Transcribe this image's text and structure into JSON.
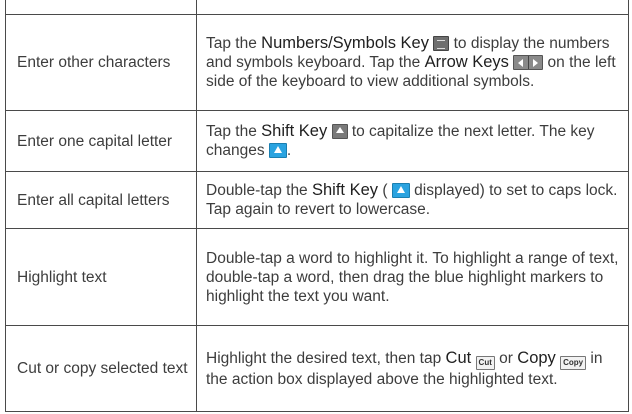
{
  "rows": [
    {
      "action": "",
      "parts": []
    },
    {
      "action": "Enter other characters",
      "t1": "Tap the ",
      "k1": "Numbers/Symbols Key",
      "t2": " to display the numbers and symbols keyboard. Tap the ",
      "k2": "Arrow Keys",
      "t3": " on the left side of the keyboard to view additional symbols."
    },
    {
      "action": "Enter one capital letter",
      "t1": "Tap the ",
      "k1": "Shift Key",
      "t2": " to capitalize the next letter. The key changes ",
      "t3": "."
    },
    {
      "action": "Enter all capital letters",
      "t1": "Double-tap the ",
      "k1": "Shift Key",
      "t2": " (",
      "t3": " displayed) to set to caps lock. Tap again to revert to lowercase."
    },
    {
      "action": "Highlight text",
      "desc": "Double-tap a word to highlight it. To highlight a range of text, double-tap a word, then drag the blue highlight markers to highlight the text you want."
    },
    {
      "action": "Cut or copy selected text",
      "t1": "Highlight the desired text, then tap ",
      "k1": "Cut",
      "icon1": "Cut",
      "t2": " or ",
      "k2": "Copy",
      "icon2": "Copy",
      "t3": " in the action box displayed above the highlighted text."
    }
  ],
  "icons": {
    "numbers_symbols": "numbers-symbols-key-icon",
    "arrows": "arrow-keys-icon",
    "shift": "shift-key-icon",
    "shift_active": "shift-key-active-icon"
  }
}
